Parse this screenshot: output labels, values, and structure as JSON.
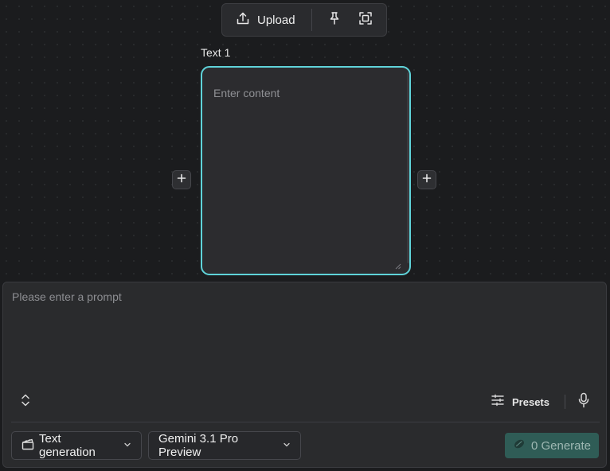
{
  "toolbar": {
    "upload_label": "Upload",
    "icons": [
      "upload-icon",
      "pin-icon",
      "frame-icon"
    ]
  },
  "node": {
    "title": "Text 1",
    "placeholder": "Enter content",
    "accent_color": "#5fd3d9"
  },
  "prompt": {
    "placeholder": "Please enter a prompt",
    "presets_label": "Presets"
  },
  "footer": {
    "mode_label": "Text generation",
    "model_label": "Gemini 3.1 Pro Preview",
    "generate_label": "0 Generate"
  },
  "colors": {
    "background": "#1b1c1e",
    "panel": "#2a2b2d",
    "generate_bg": "#2f5c56"
  }
}
